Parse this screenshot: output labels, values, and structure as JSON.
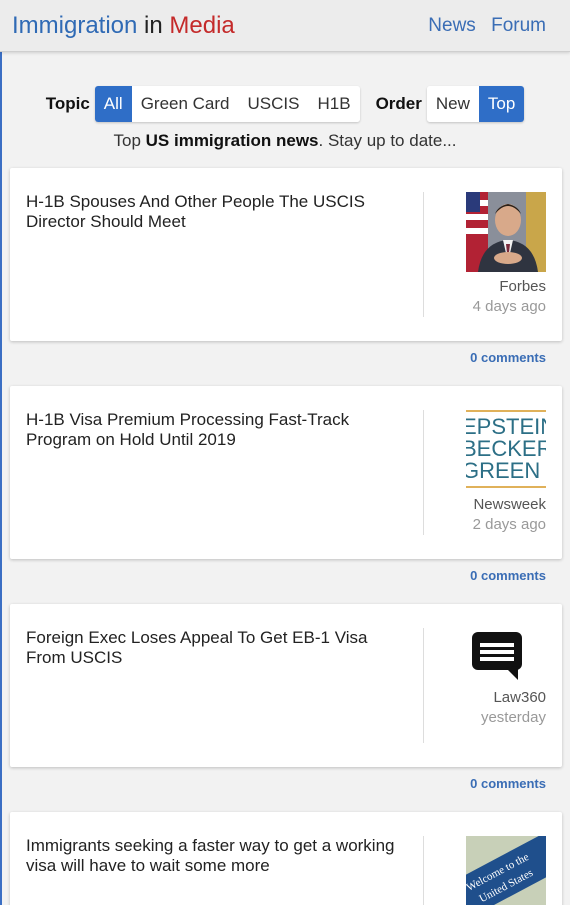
{
  "header": {
    "brand_part1": "Immigration",
    "brand_part2": "in",
    "brand_part3": "Media",
    "nav": [
      "News",
      "Forum"
    ]
  },
  "filters": {
    "topic_label": "Topic",
    "topics": [
      "All",
      "Green Card",
      "USCIS",
      "H1B"
    ],
    "active_topic": "All",
    "order_label": "Order",
    "orders": [
      "New",
      "Top"
    ],
    "active_order": "Top"
  },
  "tagline": {
    "prefix": "Top ",
    "bold": "US immigration news",
    "suffix": ". Stay up to date..."
  },
  "articles": [
    {
      "title": "H-1B Spouses And Other People The USCIS Director Should Meet",
      "source": "Forbes",
      "age": "4 days ago",
      "comments": "0 comments",
      "thumb": "person-photo"
    },
    {
      "title": "H-1B Visa Premium Processing Fast-Track Program on Hold Until 2019",
      "source": "Newsweek",
      "age": "2 days ago",
      "comments": "0 comments",
      "thumb": "logo-text",
      "thumb_text": [
        "EPSTEIN",
        "BECKER",
        "GREEN"
      ]
    },
    {
      "title": "Foreign Exec Loses Appeal To Get EB-1 Visa From USCIS",
      "source": "Law360",
      "age": "yesterday",
      "comments": "0 comments",
      "thumb": "chat-icon"
    },
    {
      "title": "Immigrants seeking a faster way to get a working visa will have to wait some more",
      "source": "",
      "age": "",
      "comments": "",
      "thumb": "welcome-sign",
      "thumb_text": [
        "Welcome to the",
        "United States"
      ]
    }
  ],
  "colors": {
    "brand_blue": "#2f6ab5",
    "brand_red": "#c42a2a",
    "active_blue": "#2f6ec7",
    "link_blue": "#3a6db5"
  }
}
